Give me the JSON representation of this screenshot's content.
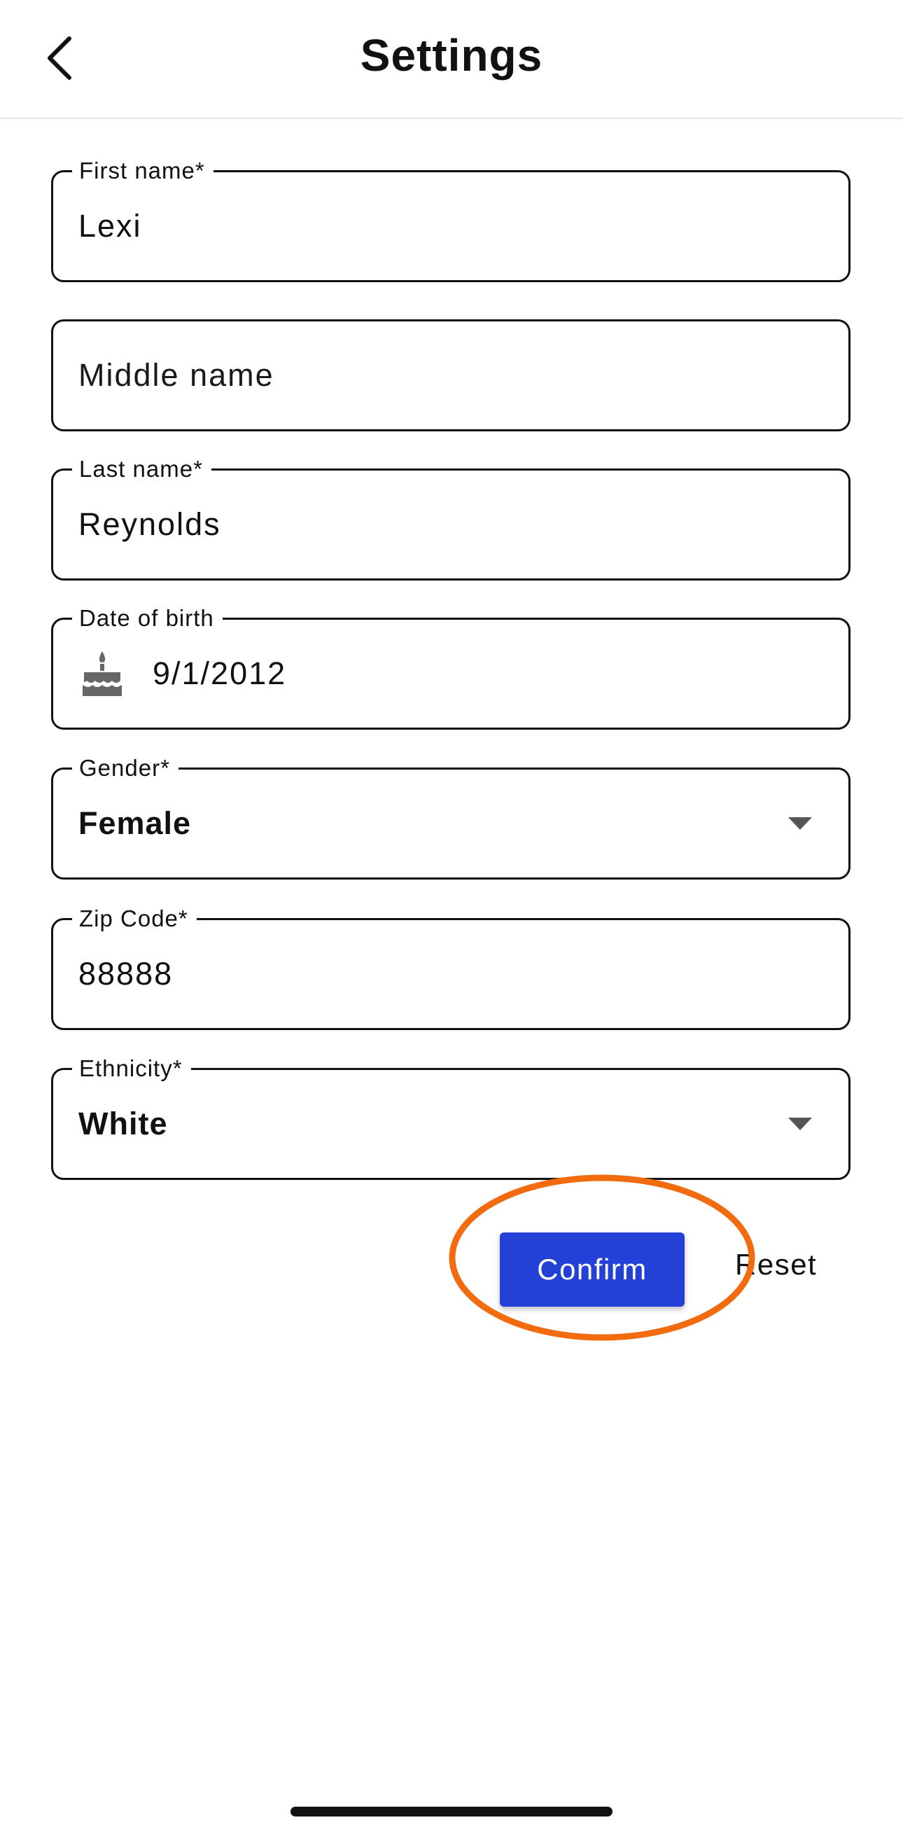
{
  "header": {
    "title": "Settings",
    "back_icon": "chevron-left-icon"
  },
  "form": {
    "first_name": {
      "label": "First name*",
      "value": "Lexi"
    },
    "middle_name": {
      "placeholder": "Middle name",
      "value": ""
    },
    "last_name": {
      "label": "Last name*",
      "value": "Reynolds"
    },
    "date_of_birth": {
      "label": "Date of birth",
      "value": "9/1/2012",
      "icon": "birthday-cake-icon"
    },
    "gender": {
      "label": "Gender*",
      "value": "Female"
    },
    "zip_code": {
      "label": "Zip Code*",
      "value": "88888"
    },
    "ethnicity": {
      "label": "Ethnicity*",
      "value": "White"
    }
  },
  "actions": {
    "confirm_label": "Confirm",
    "reset_label": "Reset"
  },
  "colors": {
    "primary": "#2341d6",
    "highlight": "#f26b0f",
    "border": "#111111"
  }
}
